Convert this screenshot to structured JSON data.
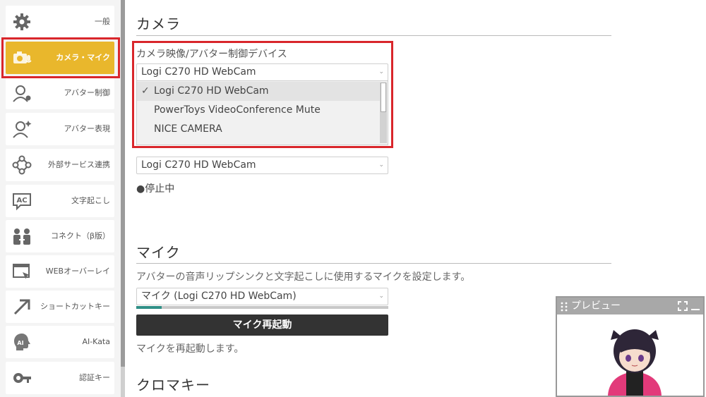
{
  "sidebar": {
    "items": [
      {
        "label": "一般",
        "icon": "gear-icon"
      },
      {
        "label": "カメラ・マイク",
        "icon": "camera-mic-icon"
      },
      {
        "label": "アバター制御",
        "icon": "avatar-control-icon"
      },
      {
        "label": "アバター表現",
        "icon": "avatar-expression-icon"
      },
      {
        "label": "外部サービス連携",
        "icon": "external-service-icon"
      },
      {
        "label": "文字起こし",
        "icon": "ac-caption-icon"
      },
      {
        "label": "コネクト（β版）",
        "icon": "connect-people-icon"
      },
      {
        "label": "WEBオーバーレイ",
        "icon": "web-overlay-icon"
      },
      {
        "label": "ショートカットキー",
        "icon": "shortcut-arrow-icon"
      },
      {
        "label": "AI-Kata",
        "icon": "ai-head-icon"
      },
      {
        "label": "認証キー",
        "icon": "auth-key-icon"
      }
    ],
    "active_index": 1,
    "accent": "#e9b72c",
    "highlight": "#d9262b"
  },
  "camera": {
    "title": "カメラ",
    "device_label": "カメラ映像/アバター制御デバイス",
    "device_value": "Logi C270 HD WebCam",
    "dropdown_options": [
      {
        "label": "Logi C270 HD WebCam",
        "selected": true
      },
      {
        "label": "PowerToys VideoConference Mute",
        "selected": false
      },
      {
        "label": "NICE CAMERA",
        "selected": false
      }
    ],
    "second_value": "Logi C270 HD WebCam",
    "status": "●停止中"
  },
  "mic": {
    "title": "マイク",
    "description": "アバターの音声リップシンクと文字起こしに使用するマイクを設定します。",
    "device_value": "マイク (Logi C270 HD WebCam)",
    "input_level": 0.1,
    "restart_button": "マイク再起動",
    "restart_note": "マイクを再起動します。"
  },
  "chroma": {
    "title": "クロマキー"
  },
  "preview": {
    "title": "プレビュー"
  }
}
